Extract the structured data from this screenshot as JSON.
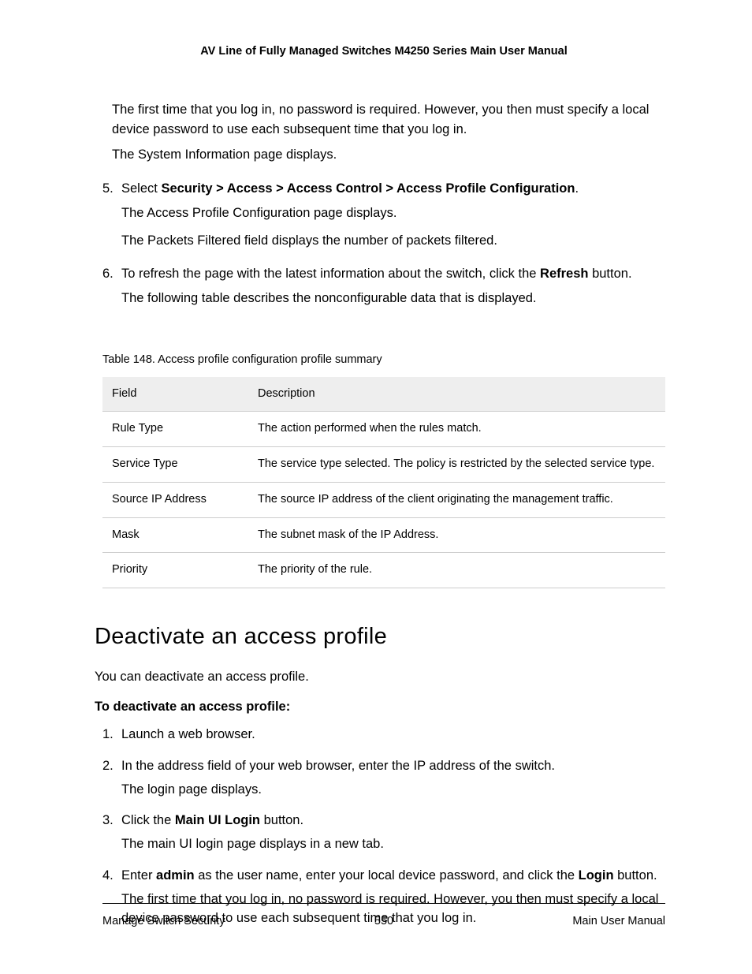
{
  "header": "AV Line of Fully Managed Switches M4250 Series Main User Manual",
  "topBlock": {
    "firstLogin": "The first time that you log in, no password is required. However, you then must specify a local device password to use each subsequent time that you log in.",
    "sysInfo": "The System Information page displays."
  },
  "step5": {
    "num": "5.",
    "selectWord": "Select ",
    "path": "Security > Access > Access Control > Access Profile Configuration",
    "dot": ".",
    "after1": "The Access Profile Configuration page displays.",
    "after2": "The Packets Filtered field displays the number of packets filtered."
  },
  "step6": {
    "num": "6.",
    "line1a": "To refresh the page with the latest information about the switch, click the ",
    "refresh": "Refresh",
    "line1b": " button.",
    "after": "The following table describes the nonconfigurable data that is displayed."
  },
  "tableTitle": "Table 148. Access profile configuration profile summary",
  "tableHeaders": {
    "field": "Field",
    "desc": "Description"
  },
  "tableRows": [
    {
      "field": "Rule Type",
      "desc": "The action performed when the rules match."
    },
    {
      "field": "Service Type",
      "desc": "The service type selected. The policy is restricted by the selected service type."
    },
    {
      "field": "Source IP Address",
      "desc": "The source IP address of the client originating the management traffic."
    },
    {
      "field": "Mask",
      "desc": "The subnet mask of the IP Address."
    },
    {
      "field": "Priority",
      "desc": "The priority of the rule."
    }
  ],
  "sectionHeading": "Deactivate an access profile",
  "sectionIntro": "You can deactivate an access profile.",
  "procTitle": "To deactivate an access profile:",
  "proc": {
    "s1": {
      "num": "1.",
      "text": "Launch a web browser."
    },
    "s2": {
      "num": "2.",
      "text": "In the address field of your web browser, enter the IP address of the switch.",
      "after": "The login page displays."
    },
    "s3": {
      "num": "3.",
      "pre": "Click the ",
      "bold": "Main UI Login",
      "post": " button.",
      "after": "The main UI login page displays in a new tab."
    },
    "s4": {
      "num": "4.",
      "a": "Enter ",
      "admin": "admin",
      "b": " as the user name, enter your local device password, and click the ",
      "login": "Login",
      "c": " button.",
      "after": "The first time that you log in, no password is required. However, you then must specify a local device password to use each subsequent time that you log in."
    }
  },
  "footer": {
    "left": "Manage Switch Security",
    "center": "550",
    "right": "Main User Manual"
  }
}
